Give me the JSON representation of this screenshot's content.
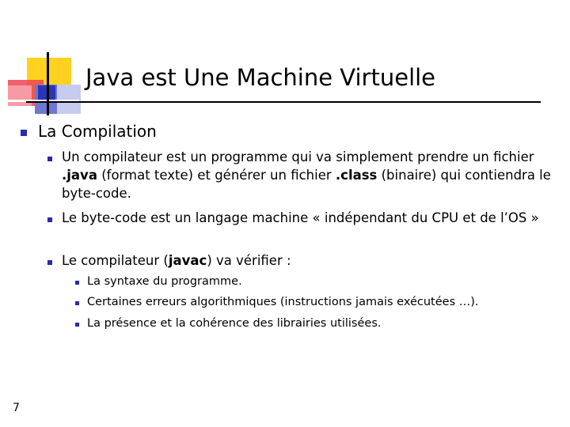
{
  "slide": {
    "title": "Java est Une Machine Virtuelle",
    "page_number": "7"
  },
  "content": {
    "heading": "La Compilation",
    "item1": {
      "text_before": "Un compilateur est un programme qui va simplement prendre un fichier ",
      "java": ".java",
      "text_middle": " (format texte) et générer un fichier ",
      "class": ".class",
      "text_after": " (binaire) qui contiendra le byte-code."
    },
    "item2": "Le byte-code est un langage machine « indépendant du CPU et de l’OS »",
    "item3": {
      "text_before": "Le compilateur (",
      "javac": "javac",
      "text_after": ") va vérifier :"
    },
    "sub_items": [
      "La syntaxe du programme.",
      "Certaines erreurs algorithmiques (instructions jamais exécutées …).",
      "La présence et la cohérence des librairies utilisées."
    ]
  },
  "colors": {
    "bullet": "#2a2aaa",
    "logo_yellow": "#ffd21f",
    "logo_red": "#ee4455",
    "logo_blue": "#2a36b4"
  }
}
